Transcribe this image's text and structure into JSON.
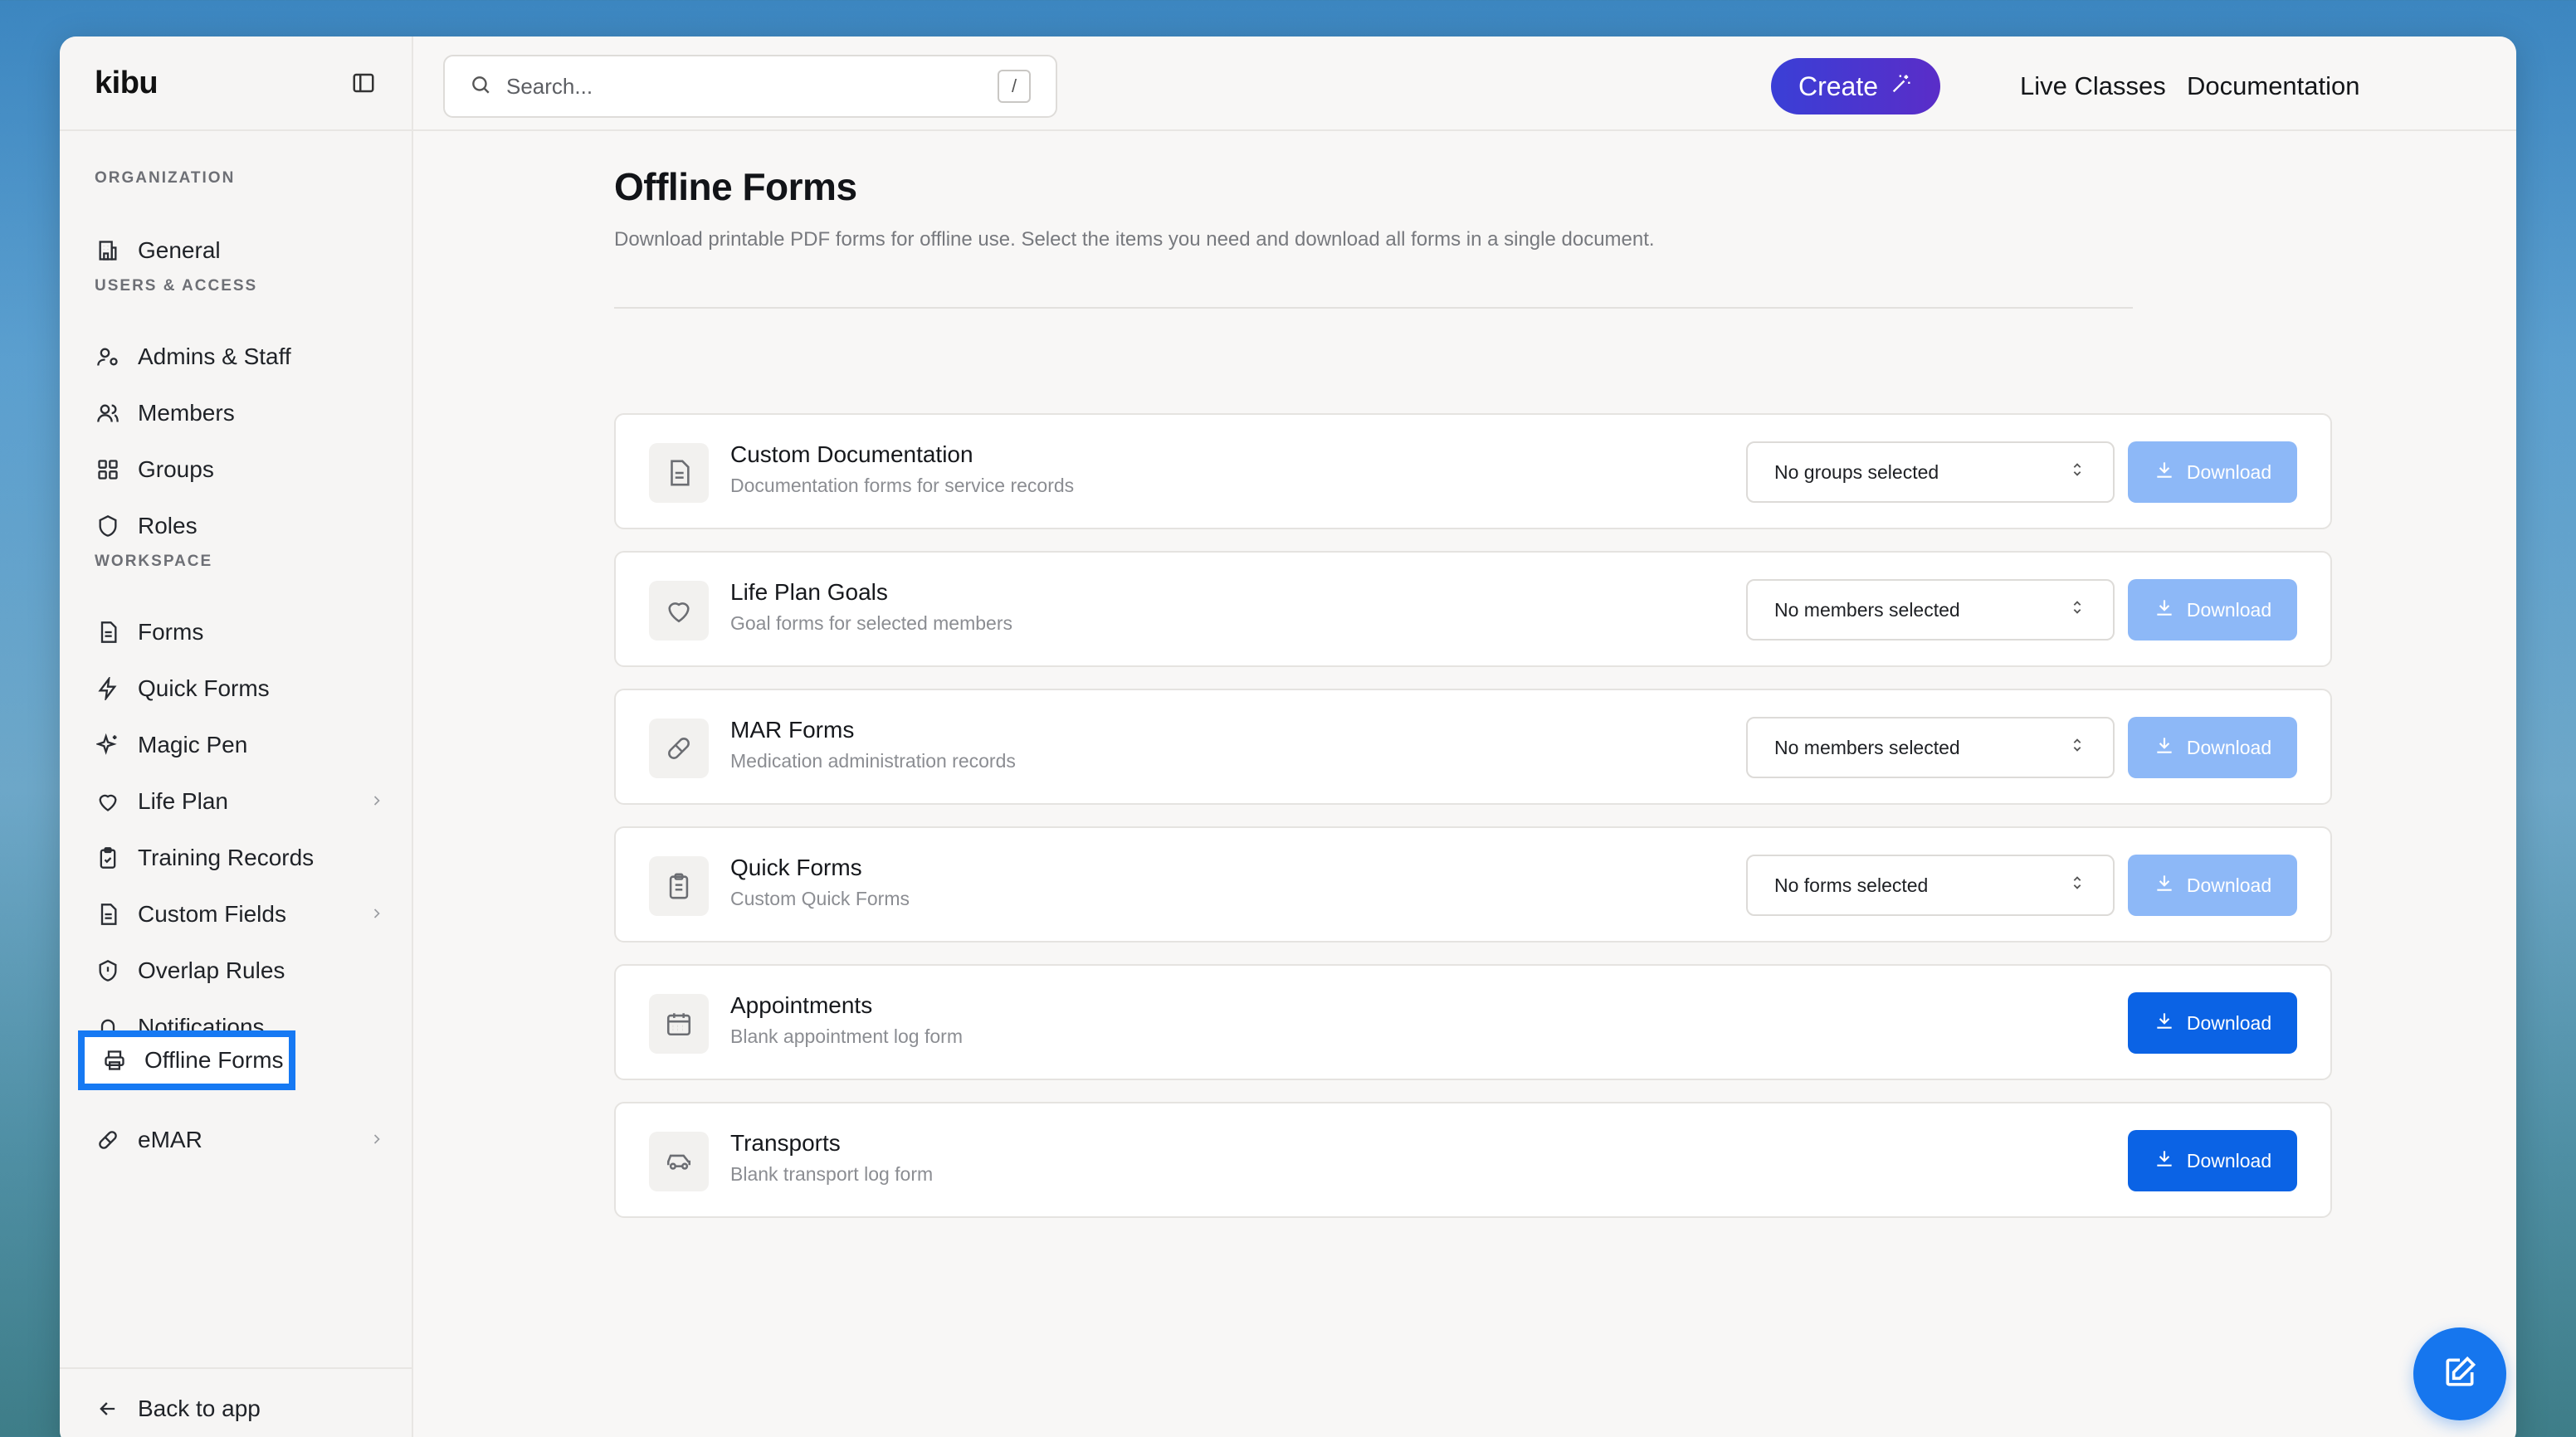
{
  "app": {
    "logo": "kibu"
  },
  "search": {
    "placeholder": "Search...",
    "shortcut": "/"
  },
  "header": {
    "create_label": "Create",
    "live_classes": "Live Classes",
    "documentation": "Documentation"
  },
  "sidebar": {
    "sections": {
      "organization": "ORGANIZATION",
      "users_access": "USERS & ACCESS",
      "workspace": "WORKSPACE"
    },
    "items": [
      {
        "label": "General",
        "icon": "building-icon"
      },
      {
        "label": "Admins & Staff",
        "icon": "user-cog-icon"
      },
      {
        "label": "Members",
        "icon": "users-icon"
      },
      {
        "label": "Groups",
        "icon": "grid-icon"
      },
      {
        "label": "Roles",
        "icon": "shield-icon"
      },
      {
        "label": "Forms",
        "icon": "document-icon"
      },
      {
        "label": "Quick Forms",
        "icon": "lightning-icon"
      },
      {
        "label": "Magic Pen",
        "icon": "sparkles-icon"
      },
      {
        "label": "Life Plan",
        "icon": "heart-icon",
        "chevron": true
      },
      {
        "label": "Training Records",
        "icon": "clipboard-check-icon"
      },
      {
        "label": "Custom Fields",
        "icon": "document-icon",
        "chevron": true
      },
      {
        "label": "Overlap Rules",
        "icon": "shield-alert-icon"
      },
      {
        "label": "Notifications",
        "icon": "bell-icon"
      },
      {
        "label": "Offline Forms",
        "icon": "printer-icon",
        "active": true
      },
      {
        "label": "eMAR",
        "icon": "pill-icon",
        "chevron": true
      }
    ],
    "back_label": "Back to app"
  },
  "page": {
    "title": "Offline Forms",
    "description": "Download printable PDF forms for offline use. Select the items you need and download all forms in a single document."
  },
  "forms": [
    {
      "title": "Custom Documentation",
      "subtitle": "Documentation forms for service records",
      "icon": "document-icon",
      "select": "No groups selected",
      "download": "Download",
      "enabled": false
    },
    {
      "title": "Life Plan Goals",
      "subtitle": "Goal forms for selected members",
      "icon": "heart-icon",
      "select": "No members selected",
      "download": "Download",
      "enabled": false
    },
    {
      "title": "MAR Forms",
      "subtitle": "Medication administration records",
      "icon": "pill-icon",
      "select": "No members selected",
      "download": "Download",
      "enabled": false
    },
    {
      "title": "Quick Forms",
      "subtitle": "Custom Quick Forms",
      "icon": "clipboard-icon",
      "select": "No forms selected",
      "download": "Download",
      "enabled": false
    },
    {
      "title": "Appointments",
      "subtitle": "Blank appointment log form",
      "icon": "calendar-icon",
      "download": "Download",
      "enabled": true
    },
    {
      "title": "Transports",
      "subtitle": "Blank transport log form",
      "icon": "car-icon",
      "download": "Download",
      "enabled": true
    }
  ],
  "colors": {
    "accent": "#0b63e5",
    "accent_disabled": "#8db8f7",
    "active_outline": "#1679f3",
    "create_gradient": [
      "#3a3fd6",
      "#5a2dc8"
    ]
  }
}
